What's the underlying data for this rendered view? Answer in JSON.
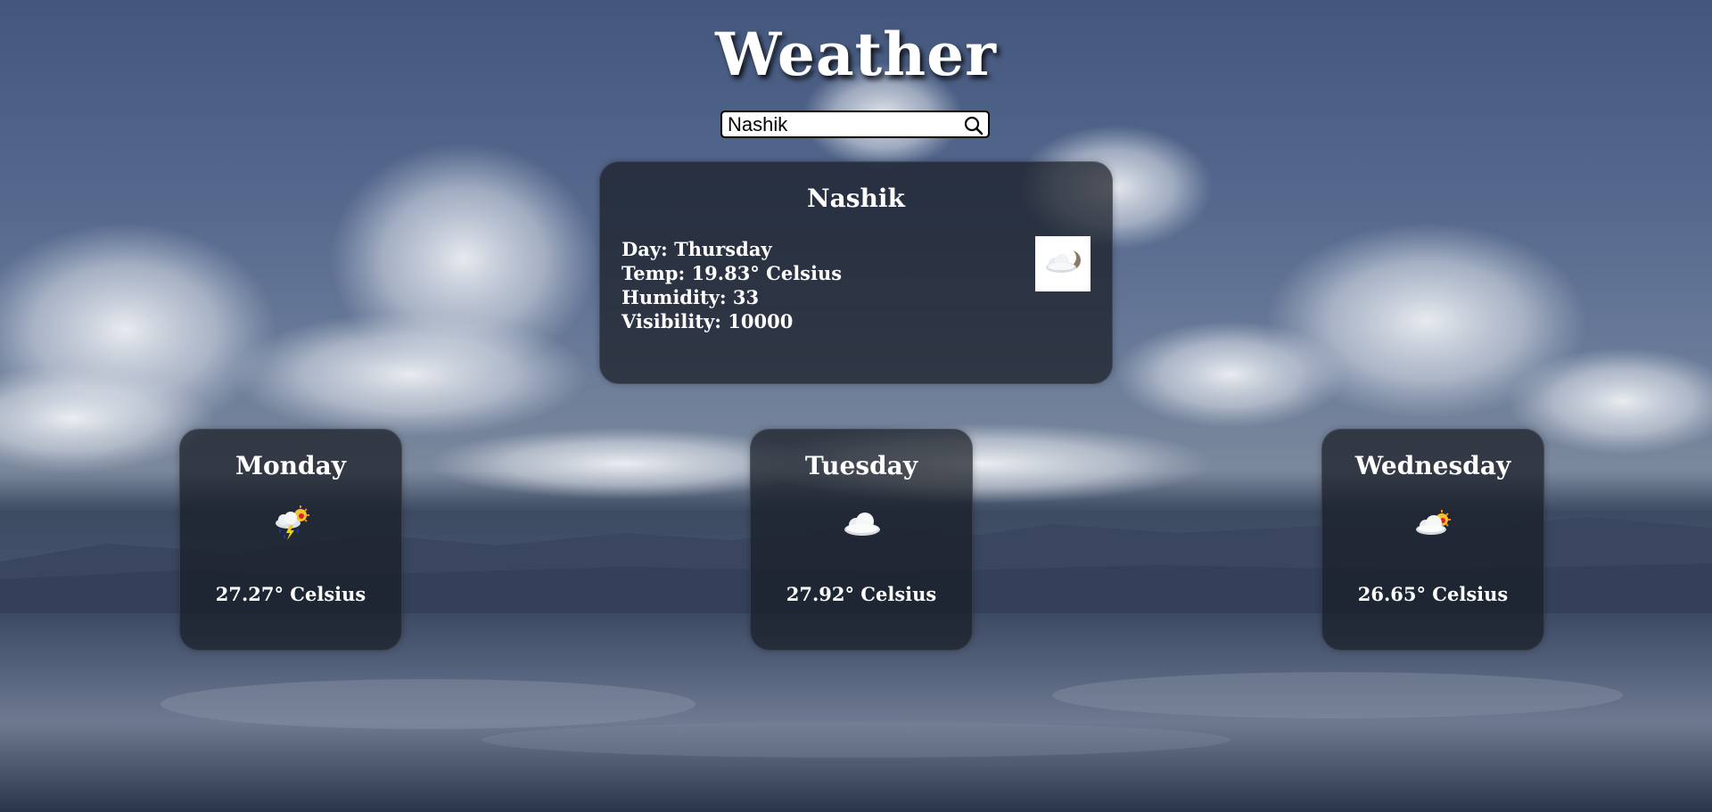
{
  "header": {
    "title": "Weather"
  },
  "search": {
    "value": "Nashik",
    "icon": "search-icon"
  },
  "current": {
    "city": "Nashik",
    "day_line": "Day: Thursday",
    "temp_line": "Temp: 19.83° Celsius",
    "humidity_line": "Humidity: 33",
    "visibility_line": "Visibility: 10000",
    "icon": "cloud-moon-icon"
  },
  "forecast": [
    {
      "day": "Monday",
      "temp": "27.27° Celsius",
      "icon": "rain-thunder-sun-icon"
    },
    {
      "day": "Tuesday",
      "temp": "27.92° Celsius",
      "icon": "cloud-icon"
    },
    {
      "day": "Wednesday",
      "temp": "26.65° Celsius",
      "icon": "cloud-sun-icon"
    }
  ],
  "colors": {
    "card_bg": "#181c24",
    "text": "#ffffff"
  }
}
